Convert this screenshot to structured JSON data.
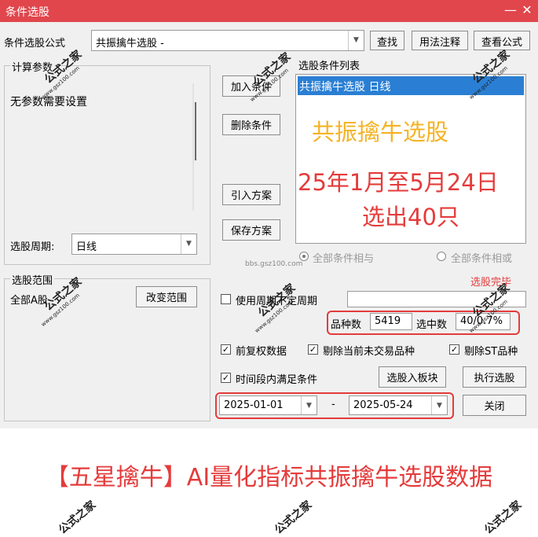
{
  "window": {
    "title": "条件选股",
    "minimize": "—",
    "close": "✕"
  },
  "formula": {
    "label": "条件选股公式",
    "value": "共振擒牛选股  -",
    "find_btn": "查找",
    "usage_btn": "用法注释",
    "view_btn": "查看公式"
  },
  "params": {
    "group_title": "计算参数",
    "message": "无参数需要设置",
    "period_label": "选股周期:",
    "period_value": "日线"
  },
  "actions": {
    "add_condition": "加入条件",
    "delete_condition": "删除条件",
    "import_plan": "引入方案",
    "save_plan": "保存方案"
  },
  "condition_list": {
    "title": "选股条件列表",
    "items": [
      "共振擒牛选股  日线"
    ],
    "overlay_title": "共振擒牛选股",
    "overlay_line1": "25年1月至5月24日",
    "overlay_line2": "选出40只"
  },
  "logic": {
    "and_label": "全部条件相与",
    "or_label": "全部条件相或"
  },
  "range": {
    "group_title": "选股范围",
    "value": "全部A股",
    "change_btn": "改变范围",
    "select_note": "选股完毕"
  },
  "options": {
    "use_period_label": "使用周期不定周期",
    "stats_count_label": "品种数",
    "stats_count_value": "5419",
    "stats_selected_label": "选中数",
    "stats_selected_value": "40/0.7%",
    "adjust_label": "前复权数据",
    "exclude_untraded_label": "剔除当前未交易品种",
    "exclude_st_label": "剔除ST品种",
    "time_range_label": "时间段内满足条件",
    "to_board_btn": "选股入板块",
    "run_btn": "执行选股",
    "start_date": "2025-01-01",
    "date_sep": "-",
    "end_date": "2025-05-24",
    "close_btn": "关闭"
  },
  "banner": {
    "text": "【五星擒牛】AI量化指标共振擒牛选股数据"
  },
  "watermark": {
    "big": "公式之家",
    "small": "www.gsz100.com",
    "url": "bbs.gsz100.com"
  },
  "colors": {
    "titlebar": "#e0464c",
    "accent_red": "#e53b3b",
    "overlay_yellow": "#f5b324",
    "selection_blue": "#2a7fd4"
  }
}
